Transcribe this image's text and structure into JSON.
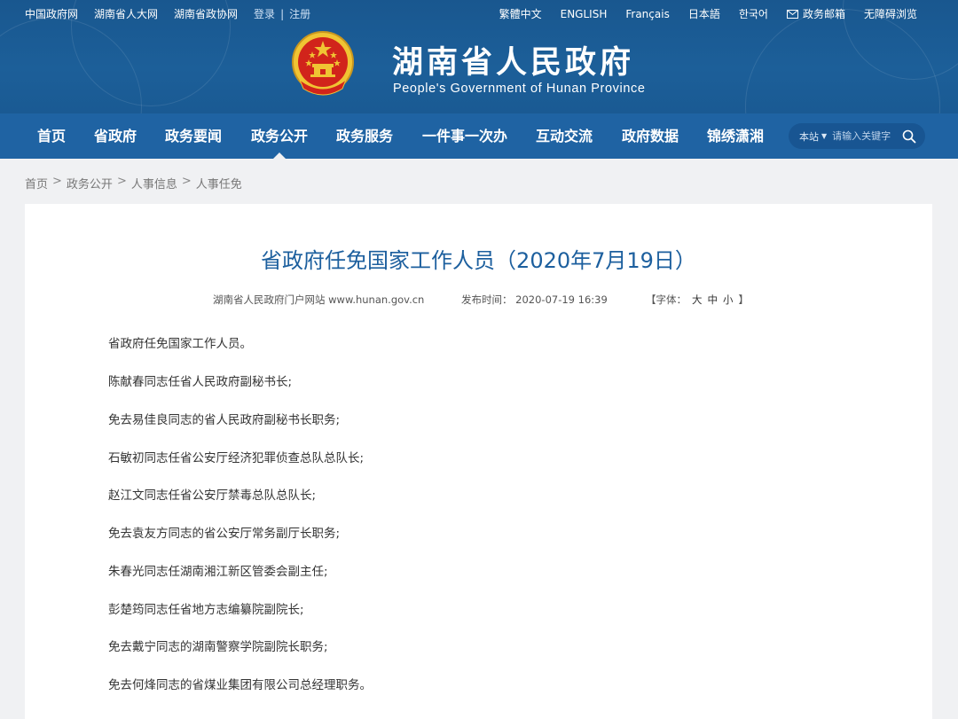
{
  "header": {
    "top_links_left": [
      "中国政府网",
      "湖南省人大网",
      "湖南省政协网"
    ],
    "login": "登录",
    "login_sep": "|",
    "register": "注册",
    "top_links_right": [
      "繁體中文",
      "ENGLISH",
      "Français",
      "日本語",
      "한국어"
    ],
    "mail_label": "政务邮箱",
    "accessibility": "无障碍浏览",
    "title": "湖南省人民政府",
    "subtitle": "People's Government of Hunan Province"
  },
  "nav": {
    "items": [
      "首页",
      "省政府",
      "政务要闻",
      "政务公开",
      "政务服务",
      "一件事一次办",
      "互动交流",
      "政府数据",
      "锦绣潇湘"
    ],
    "active": "政务公开",
    "search_scope": "本站",
    "search_placeholder": "请输入关键字"
  },
  "breadcrumb": {
    "items": [
      "首页",
      "政务公开",
      "人事信息",
      "人事任免"
    ],
    "separator": ">"
  },
  "article": {
    "title": "省政府任免国家工作人员（2020年7月19日）",
    "source": "湖南省人民政府门户网站 www.hunan.gov.cn",
    "date_label": "发布时间：",
    "date": "2020-07-19 16:39",
    "font_label": "【字体：",
    "font_large": "大",
    "font_medium": "中",
    "font_small": "小",
    "font_close": "】",
    "paragraphs": [
      "省政府任免国家工作人员。",
      "陈献春同志任省人民政府副秘书长;",
      "免去易佳良同志的省人民政府副秘书长职务;",
      "石敏初同志任省公安厅经济犯罪侦查总队总队长;",
      "赵江文同志任省公安厅禁毒总队总队长;",
      "免去袁友方同志的省公安厅常务副厅长职务;",
      "朱春光同志任湖南湘江新区管委会副主任;",
      "彭楚筠同志任省地方志编纂院副院长;",
      "免去戴宁同志的湖南警察学院副院长职务;",
      "免去何烽同志的省煤业集团有限公司总经理职务。"
    ]
  },
  "colors": {
    "header_bg": "#1a5a93",
    "nav_bg": "#1f63a3",
    "title_blue": "#1c5f9e",
    "page_bg": "#f0f1f3",
    "emblem_red": "#d1241b",
    "emblem_gold": "#f0c433"
  }
}
